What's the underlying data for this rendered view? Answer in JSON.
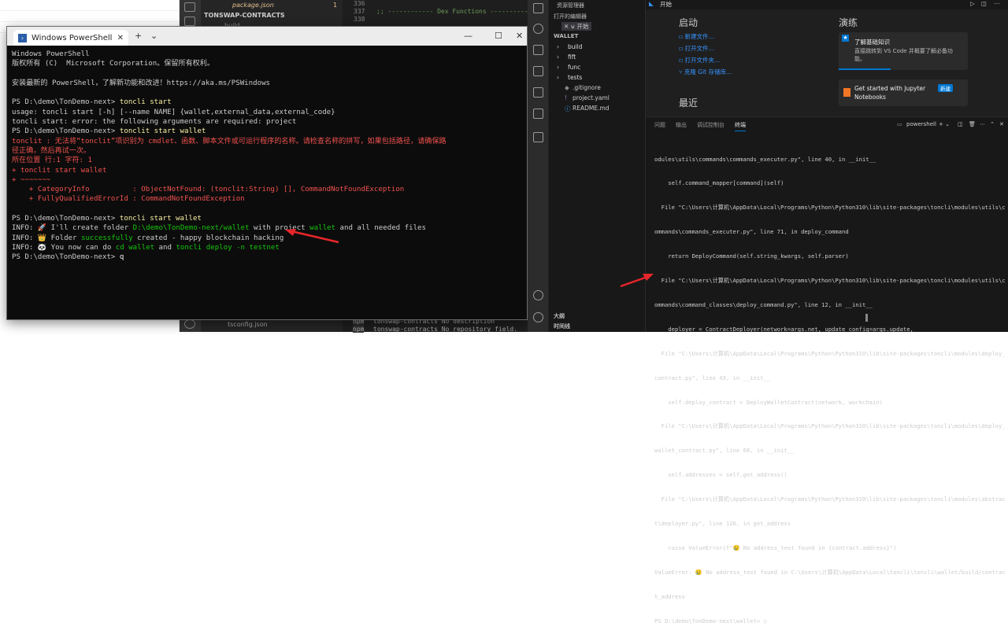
{
  "bg": {
    "package_json": "package.json",
    "pkg_num": "1",
    "tonswap": "TONSWAP-CONTRACTS",
    "build": "build",
    "tsconfig": "tsconfig.json",
    "ln336": "336",
    "ln337": "337",
    "ln338": "338",
    "dex_comment": ";; ------------ Dex Functions ------------",
    "npm1": "npm",
    "npm1_text": "tonswap-contracts No description",
    "npm2": "npm",
    "npm2_text": "tonswap-contracts No repository field."
  },
  "ps": {
    "tab_title": "Windows PowerShell",
    "new_tab": "+",
    "dropdown": "⌄",
    "minimize": "—",
    "maximize": "☐",
    "close": "✕",
    "tab_close": "✕",
    "lines": [
      {
        "t": "Windows PowerShell",
        "c": ""
      },
      {
        "t": "版权所有 (C)  Microsoft Corporation。保留所有权利。",
        "c": ""
      },
      {
        "t": "",
        "c": ""
      },
      {
        "t": "安装最新的 PowerShell，了解新功能和改进！https://aka.ms/PSWindows",
        "c": ""
      },
      {
        "t": "",
        "c": ""
      }
    ],
    "l6_prompt": "PS D:\\demo\\TonDemo-next> ",
    "l6_cmd": "toncli start",
    "l7": "usage: toncli start [-h] [--name NAME] {wallet,external_data,external_code}",
    "l8": "toncli start: error: the following arguments are required: project",
    "l9_prompt": "PS D:\\demo\\TonDemo-next> ",
    "l9_cmd": "tonclit start wallet",
    "err1": "tonclit : 无法将“tonclit”项识别为 cmdlet、函数、脚本文件或可运行程序的名称。请检查名称的拼写，如果包括路径，请确保路",
    "err2": "径正确，然后再试一次。",
    "err3": "所在位置 行:1 字符: 1",
    "err4": "+ tonclit start wallet",
    "err5": "+ ~~~~~~~",
    "err6": "    + CategoryInfo          : ObjectNotFound: (tonclit:String) [], CommandNotFoundException",
    "err7": "    + FullyQualifiedErrorId : CommandNotFoundException",
    "l17_prompt": "PS D:\\demo\\TonDemo-next> ",
    "l17_cmd": "toncli start wallet",
    "info1_a": "INFO: 🚀 I'll create folder ",
    "info1_path": "D:\\demo\\TonDemo-next/wallet",
    "info1_b": " with project ",
    "info1_w": "wallet",
    "info1_c": " and all needed files",
    "info2_a": "INFO: 👑 Folder ",
    "info2_s": "successfully",
    "info2_b": " created - happy blockchain hacking",
    "info3_a": "INFO: 🐼 You now can do ",
    "info3_cd": "cd wallet",
    "info3_and": " and ",
    "info3_deploy": "toncli deploy -n testnet",
    "last_prompt": "PS D:\\demo\\TonDemo-next> ",
    "last_input": "q"
  },
  "vs": {
    "explorer_title": "资源管理器",
    "open_editors": "打开的编辑器",
    "open_editor_item": "✕ ⊌ 开始",
    "wallet": "WALLET",
    "tree": [
      {
        "label": "build",
        "icon": "›"
      },
      {
        "label": "fift",
        "icon": "›"
      },
      {
        "label": "func",
        "icon": "›"
      },
      {
        "label": "tests",
        "icon": "›"
      },
      {
        "label": ".gitignore",
        "icon": "◆"
      },
      {
        "label": "project.yaml",
        "icon": "!"
      },
      {
        "label": "README.md",
        "icon": "ⓘ"
      }
    ],
    "outline": "大纲",
    "timeline": "时间线",
    "editor_tab": "开始",
    "start_heading": "启动",
    "start_links": [
      "新建文件...",
      "打开文件...",
      "打开文件夹...",
      "克隆 Git 存储库..."
    ],
    "recent_heading": "最近",
    "walk_heading": "演练",
    "card1_title": "了解基础知识",
    "card1_desc1": "直接跳转到 VS Code 并概要了解必备功",
    "card1_desc2": "能。",
    "card2_title1": "Get started with Jupyter",
    "card2_title2": "Notebooks",
    "card2_badge": "新建",
    "term_tabs": [
      "问题",
      "输出",
      "调试控制台",
      "终端"
    ],
    "term_shell": "powershell",
    "term_lines": [
      "odules\\utils\\commands\\commands_executer.py\", line 40, in __init__",
      "    self.command_mapper[command](self)",
      "  File \"C:\\Users\\计算机\\AppData\\Local\\Programs\\Python\\Python310\\lib\\site-packages\\toncli\\modules\\utils\\c",
      "ommands\\commands_executer.py\", line 71, in deploy_command",
      "    return DeployCommand(self.string_kwargs, self.parser)",
      "  File \"C:\\Users\\计算机\\AppData\\Local\\Programs\\Python\\Python310\\lib\\site-packages\\toncli\\modules\\utils\\c",
      "ommands\\command_classes\\deploy_command.py\", line 12, in __init__",
      "    deployer = ContractDeployer(network=args.net, update_config=args.update,",
      "  File \"C:\\Users\\计算机\\AppData\\Local\\Programs\\Python\\Python310\\lib\\site-packages\\toncli\\modules\\deploy_",
      "contract.py\", line 43, in __init__",
      "    self.deploy_contract = DeployWalletContract(network, workchain)",
      "  File \"C:\\Users\\计算机\\AppData\\Local\\Programs\\Python\\Python310\\lib\\site-packages\\toncli\\modules\\deploy_",
      "wallet_contract.py\", line 68, in __init__",
      "    self.addresses = self.get_address()",
      "  File \"C:\\Users\\计算机\\AppData\\Local\\Programs\\Python\\Python310\\lib\\site-packages\\toncli\\modules\\abstrac",
      "t\\deployer.py\", line 126, in get_address",
      "    raise ValueError(f\"😢 No address_text found in {contract.address}\")",
      "ValueError: 😢 No address_text found in C:\\Users\\计算机\\AppData\\Local\\toncli\\toncli\\wallet/build/contrac",
      "t_address",
      "PS D:\\demo\\TonDemo-next\\wallet> ▯"
    ]
  },
  "colors": {
    "arrow": "#e8262b",
    "ps_bg": "#0c0c0c",
    "ps_error": "#f0524f",
    "ps_green": "#16c60c",
    "vs_link": "#3794ff",
    "vs_accent": "#0078d4"
  }
}
